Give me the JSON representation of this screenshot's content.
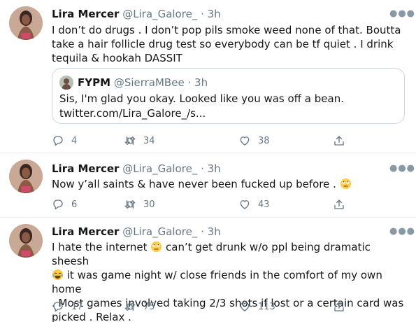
{
  "tweets": [
    {
      "name": "Lira Mercer",
      "handle": "@Lira_Galore_",
      "dot": "·",
      "time": "3h",
      "more_icon": "more-horizontal-icon",
      "text": "I don’t do drugs . I don’t pop pils smoke weed none of that. Boutta take a hair follicle drug test so everybody can be tf quiet . I drink tequila & hookah DASSIT",
      "quote": {
        "name": "FYPM",
        "handle": "@SierraMBee",
        "dot": "·",
        "time": "3h",
        "line1": "Sis, I'm glad you okay. Looked like you was off a bean.",
        "line2": "twitter.com/Lira_Galore_/s..."
      },
      "replies": "4",
      "retweets": "34",
      "likes": "38"
    },
    {
      "name": "Lira Mercer",
      "handle": "@Lira_Galore_",
      "dot": "·",
      "time": "3h",
      "text_before_emoji": "Now y’all saints & have never been fucked up before . ",
      "emoji": "rolling-eyes-emoji",
      "replies": "6",
      "retweets": "30",
      "likes": "43"
    },
    {
      "name": "Lira Mercer",
      "handle": "@Lira_Galore_",
      "dot": "·",
      "time": "3h",
      "line1_a": "I hate the internet ",
      "line1_b": " can’t get drunk w/o ppl being dramatic sheesh",
      "line2_b": " it was game night w/ close friends in the comfort of my own home",
      "line3": ". Most games involved taking 2/3 shots if lost or a certain card was",
      "line4": "picked . Relax .",
      "emoji1": "rolling-eyes-emoji",
      "emoji2": "tears-of-joy-emoji",
      "replies": "17",
      "retweets": "75",
      "likes": "113"
    }
  ],
  "colors": {
    "text": "#14171a",
    "secondary": "#657786",
    "border": "#e6ecf0",
    "quote_border": "#ccd6dd"
  },
  "icons": [
    "reply-icon",
    "retweet-icon",
    "like-icon",
    "share-icon"
  ]
}
